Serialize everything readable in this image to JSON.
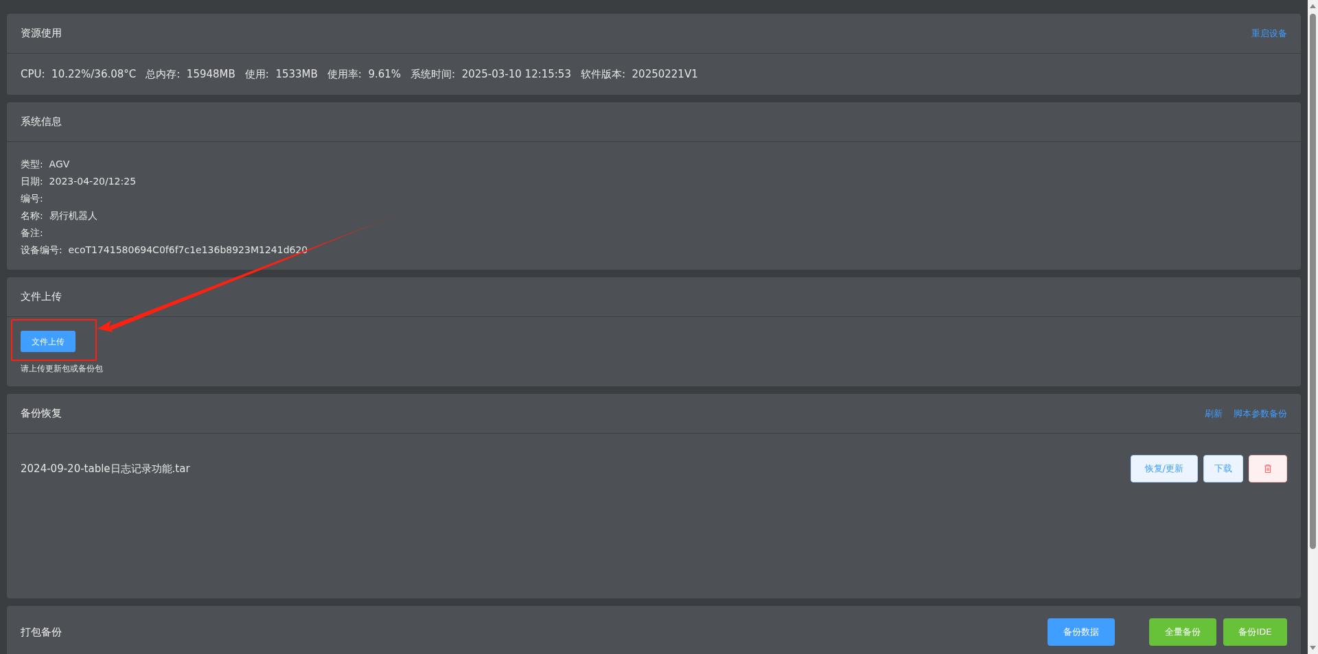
{
  "resource_usage": {
    "title": "资源使用",
    "link": "重启设备",
    "stats": [
      {
        "label": "CPU:",
        "value": "10.22%/36.08°C"
      },
      {
        "label": "总内存:",
        "value": "15948MB"
      },
      {
        "label": "使用:",
        "value": "1533MB"
      },
      {
        "label": "使用率:",
        "value": "9.61%"
      },
      {
        "label": "系统时间:",
        "value": "2025-03-10 12:15:53"
      },
      {
        "label": "软件版本:",
        "value": "20250221V1"
      }
    ]
  },
  "system_info": {
    "title": "系统信息",
    "fields": [
      {
        "label": "类型:",
        "value": "AGV"
      },
      {
        "label": "日期:",
        "value": "2023-04-20/12:25"
      },
      {
        "label": "编号:"
      },
      {
        "label": "名称:",
        "value": "易行机器人"
      },
      {
        "label": "备注:"
      },
      {
        "label": "设备编号:",
        "value": "ecoT1741580694C0f6f7c1e136b8923M1241d620"
      }
    ]
  },
  "file_upload": {
    "title": "文件上传",
    "button": "文件上传",
    "hint": "请上传更新包或备份包"
  },
  "backup_restore": {
    "title": "备份恢复",
    "links": [
      "刷新",
      "脚本参数备份"
    ],
    "files": [
      {
        "name": "2024-09-20-table日志记录功能.tar",
        "restore": "恢复/更新",
        "download": "下载"
      }
    ]
  },
  "pack_backup": {
    "title": "打包备份",
    "buttons": [
      {
        "label": "备份数据",
        "kind": "primary"
      },
      {
        "label": "全量备份",
        "kind": "success"
      },
      {
        "label": "备份IDE",
        "kind": "success"
      }
    ]
  },
  "annotation": {
    "highlight_box": true,
    "arrow": true
  }
}
